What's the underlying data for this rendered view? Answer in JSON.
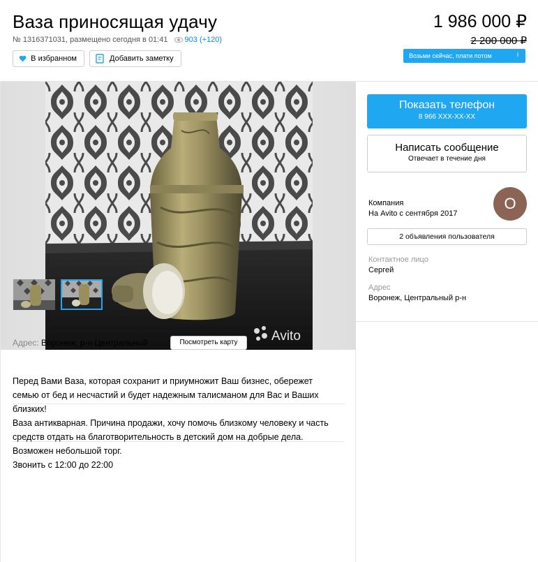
{
  "listing": {
    "title": "Ваза приносящая удачу",
    "meta_text": "№ 1316371031, размещено сегодня в 01:41",
    "views": "903 (+120)",
    "price": "1 986 000 ₽",
    "old_price": "2 200 000 ₽",
    "buy_now_label": "Возьми сейчас, плати потом",
    "buy_now_info": "i"
  },
  "actions": {
    "favorite_label": "В избранном",
    "note_label": "Добавить заметку"
  },
  "gallery": {
    "watermark": "Avito",
    "selected_index": 1
  },
  "address": {
    "label": "Адрес:",
    "value": "Воронеж, р-н Центральный",
    "map_button": "Посмотреть карту"
  },
  "description": {
    "text": "Перед Вами Ваза, которая сохранит и приумножит Ваш бизнес, обережет\nсемью от бед и несчастий и будет надежным талисманом для Вас и Ваших\nблизких!\nВаза антикварная. Причина продажи, хочу помочь близкому человеку и часть\nсредств отдать на благотворительность в детский дом на добрые дела.\nВозможен небольшой торг.\nЗвонить с 12:00 до 22:00"
  },
  "contact": {
    "phone_button": "Показать телефон",
    "phone_masked": "8 966 XXX-XX-XX",
    "message_button": "Написать сообщение",
    "message_subtext": "Отвечает в течение дня",
    "seller_type": "Компания",
    "seller_since": "На Avito с сентября 2017",
    "avatar_letter": "О",
    "listings_button": "2 объявления пользователя",
    "contact_person_label": "Контактное лицо",
    "contact_person": "Сергей",
    "address_label": "Адрес",
    "address_value": "Воронеж, Центральный р-н"
  },
  "colors": {
    "accent": "#1fa8f1",
    "link": "#0a8ad8",
    "avatar": "#8c6456"
  }
}
